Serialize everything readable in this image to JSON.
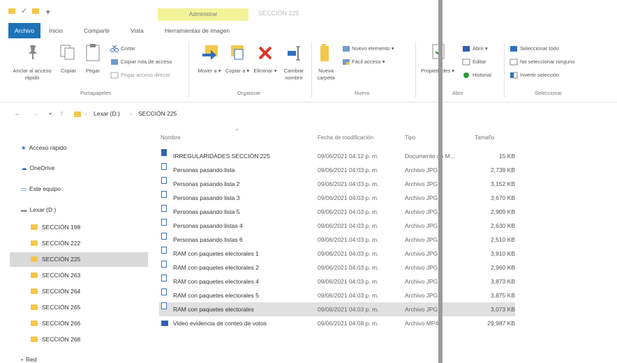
{
  "titlebar": {
    "tool_context": "Administrar",
    "window_title": "SECCIÓN 225"
  },
  "tabs": [
    "Archivo",
    "Inicio",
    "Compartir",
    "Vista",
    "Herramientas de imagen"
  ],
  "ribbon": {
    "pin_label": "Anclar al acceso rápido",
    "copy_label": "Copiar",
    "paste_label": "Pegar",
    "cut_label": "Cortar",
    "copy_path_label": "Copiar ruta de acceso",
    "paste_shortcut_label": "Pegar acceso directo",
    "clipboard_group": "Portapapeles",
    "move_label": "Mover a",
    "copyto_label": "Copiar a",
    "delete_label": "Eliminar",
    "rename_label": "Cambiar nombre",
    "organize_group": "Organizar",
    "newfolder_label": "Nueva carpeta",
    "newitem_label": "Nuevo elemento",
    "easyaccess_label": "Fácil acceso",
    "new_group": "Nuevo",
    "properties_label": "Propiedades",
    "open_label": "Abrir",
    "edit_label": "Editar",
    "history_label": "Historial",
    "open_group": "Abrir",
    "select_all_label": "Seleccionar todo",
    "select_none_label": "No seleccionar ninguno",
    "invert_label": "Invertir selección",
    "select_group": "Seleccionar"
  },
  "address": {
    "drive": "Lexar (D:)",
    "folder": "SECCIÓN 225"
  },
  "navpane": {
    "quick_access": "Acceso rápido",
    "onedrive": "OneDrive",
    "this_pc": "Este equipo",
    "drive": "Lexar (D:)",
    "folders": [
      "SECCIÓN 198",
      "SECCIÓN 222",
      "SECCIÓN 225",
      "SECCIÓN 263",
      "SECCIÓN 264",
      "SECCIÓN 265",
      "SECCIÓN 266",
      "SECCIÓN 268"
    ],
    "network": "Red"
  },
  "columns": {
    "name": "Nombre",
    "date": "Fecha de modificación",
    "type": "Tipo",
    "size": "Tamaño"
  },
  "files": [
    {
      "name": "IRREGULARIDADES SECCIÓN 225",
      "date": "09/06/2021 04:12 p. m.",
      "type": "Documento de M...",
      "size": "15 KB",
      "icon": "word-doc-icon"
    },
    {
      "name": "Personas pasando lista",
      "date": "09/06/2021 04:03 p. m.",
      "type": "Archivo JPG",
      "size": "2,738 KB",
      "icon": "image-file-icon"
    },
    {
      "name": "Personas pasando lista 2",
      "date": "09/06/2021 04:03 p. m.",
      "type": "Archivo JPG",
      "size": "3,152 KB",
      "icon": "image-file-icon"
    },
    {
      "name": "Personas pasando lista 3",
      "date": "09/06/2021 04:03 p. m.",
      "type": "Archivo JPG",
      "size": "3,670 KB",
      "icon": "image-file-icon"
    },
    {
      "name": "Personas pasando lista 5",
      "date": "09/06/2021 04:03 p. m.",
      "type": "Archivo JPG",
      "size": "2,909 KB",
      "icon": "image-file-icon"
    },
    {
      "name": "Personas pasando listas 4",
      "date": "09/06/2021 04:03 p. m.",
      "type": "Archivo JPG",
      "size": "2,630 KB",
      "icon": "image-file-icon"
    },
    {
      "name": "Personas pasando listas 6",
      "date": "09/06/2021 04:03 p. m.",
      "type": "Archivo JPG",
      "size": "2,510 KB",
      "icon": "image-file-icon"
    },
    {
      "name": "RAM con paquetes electorales 1",
      "date": "09/06/2021 04:03 p. m.",
      "type": "Archivo JPG",
      "size": "3,910 KB",
      "icon": "image-file-icon"
    },
    {
      "name": "RAM con paquetes electorales 2",
      "date": "09/06/2021 04:03 p. m.",
      "type": "Archivo JPG",
      "size": "2,960 KB",
      "icon": "image-file-icon"
    },
    {
      "name": "RAM con paquetes electorales 4",
      "date": "09/06/2021 04:03 p. m.",
      "type": "Archivo JPG",
      "size": "3,873 KB",
      "icon": "image-file-icon"
    },
    {
      "name": "RAM con paquetes electorales 5",
      "date": "09/06/2021 04:03 p. m.",
      "type": "Archivo JPG",
      "size": "3,875 KB",
      "icon": "image-file-icon"
    },
    {
      "name": "RAM con paquetes electorales",
      "date": "09/06/2021 04:03 p. m.",
      "type": "Archivo JPG",
      "size": "3,073 KB",
      "icon": "image-file-icon",
      "selected": true
    },
    {
      "name": "Video evidencia de conteo de votos",
      "date": "09/06/2021 04:08 p. m.",
      "type": "Archivo MP4",
      "size": "29,987 KB",
      "icon": "video-file-icon"
    }
  ]
}
